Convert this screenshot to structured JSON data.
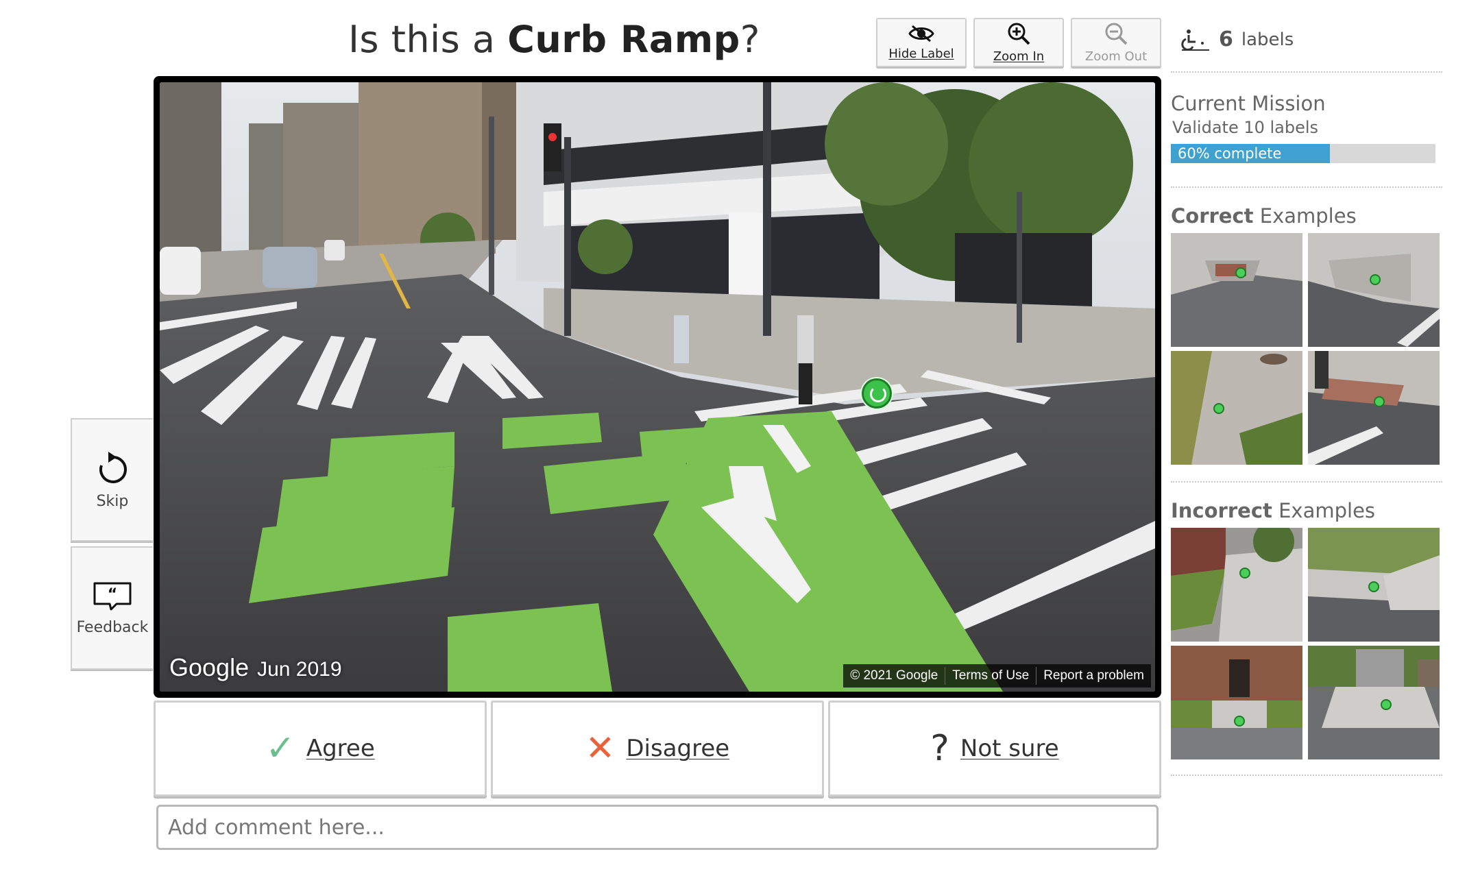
{
  "header": {
    "question_prefix": "Is this a ",
    "label_type": "Curb Ramp",
    "question_suffix": "?"
  },
  "toolbar": {
    "hide_label": "Hide Label",
    "zoom_in": "Zoom In",
    "zoom_out": "Zoom Out"
  },
  "side": {
    "skip": "Skip",
    "feedback": "Feedback"
  },
  "panorama": {
    "logo": "Google",
    "date": "Jun 2019",
    "copyright": "© 2021 Google",
    "terms": "Terms of Use",
    "report": "Report a problem"
  },
  "answers": {
    "agree": "Agree",
    "agree_symbol": "✓",
    "disagree": "Disagree",
    "disagree_symbol": "✕",
    "not_sure": "Not sure",
    "not_sure_symbol": "?"
  },
  "comment": {
    "placeholder": "Add comment here..."
  },
  "status": {
    "label_count": "6",
    "label_word": "labels"
  },
  "mission": {
    "title": "Current Mission",
    "description": "Validate 10 labels",
    "progress_text": "60% complete",
    "progress_fraction": 0.6
  },
  "examples": {
    "correct_bold": "Correct",
    "incorrect_bold": "Incorrect",
    "suffix": " Examples"
  },
  "colors": {
    "accent_progress": "#3ea1d0",
    "agree_check": "#6bbf8e",
    "disagree_x": "#e8623a",
    "marker": "#3cc24a"
  }
}
